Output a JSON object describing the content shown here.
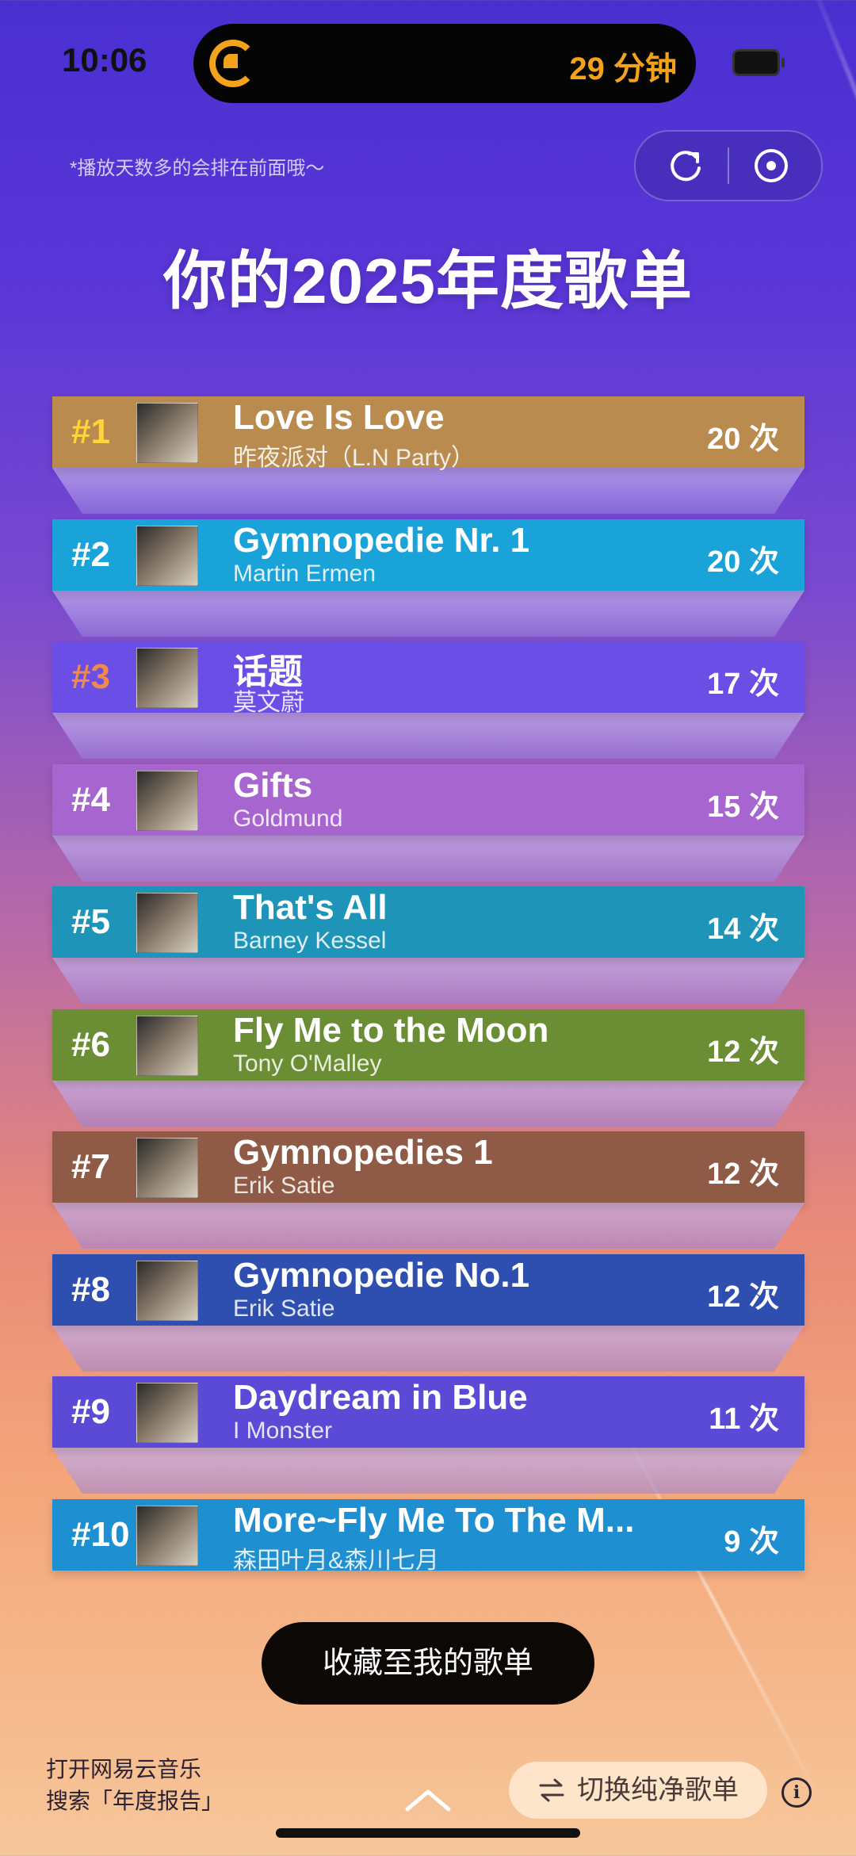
{
  "status": {
    "time": "10:06",
    "island_text": "29 分钟"
  },
  "hint": "*播放天数多的会排在前面哦～",
  "title": "你的2025年度歌单",
  "songs": [
    {
      "rank": "#1",
      "title": "Love Is Love",
      "artist": "昨夜派对（L.N Party）",
      "count": "20 次",
      "color": "#b98b4f",
      "rank_color": "#ffd43a"
    },
    {
      "rank": "#2",
      "title": "Gymnopedie Nr. 1",
      "artist": "Martin Ermen",
      "count": "20 次",
      "color": "#1aa3d8",
      "rank_color": "#ffffff"
    },
    {
      "rank": "#3",
      "title": "话题",
      "artist": "莫文蔚",
      "count": "17 次",
      "color": "#6a4ee6",
      "rank_color": "#f08a4a"
    },
    {
      "rank": "#4",
      "title": "Gifts",
      "artist": "Goldmund",
      "count": "15 次",
      "color": "#a765cf",
      "rank_color": "#ffffff"
    },
    {
      "rank": "#5",
      "title": "That's All",
      "artist": "Barney Kessel",
      "count": "14 次",
      "color": "#1e95b8",
      "rank_color": "#ffffff"
    },
    {
      "rank": "#6",
      "title": "Fly Me to the Moon",
      "artist": "Tony O'Malley",
      "count": "12 次",
      "color": "#6b8e34",
      "rank_color": "#ffffff"
    },
    {
      "rank": "#7",
      "title": "Gymnopedies 1",
      "artist": "Erik Satie",
      "count": "12 次",
      "color": "#8f5a46",
      "rank_color": "#ffffff"
    },
    {
      "rank": "#8",
      "title": "Gymnopedie No.1",
      "artist": "Erik Satie",
      "count": "12 次",
      "color": "#2e4fb0",
      "rank_color": "#ffffff"
    },
    {
      "rank": "#9",
      "title": "Daydream in Blue",
      "artist": "I Monster",
      "count": "11 次",
      "color": "#5a4ad6",
      "rank_color": "#ffffff"
    },
    {
      "rank": "#10",
      "title": "More~Fly Me To The M...",
      "artist": "森田叶月&森川七月",
      "count": "9 次",
      "color": "#1e8fd0",
      "rank_color": "#ffffff"
    }
  ],
  "collect_button": "收藏至我的歌单",
  "bottom_hint_line1": "打开网易云音乐",
  "bottom_hint_line2": "搜索「年度报告」",
  "switch_button": "切换纯净歌单",
  "info_label": "i"
}
